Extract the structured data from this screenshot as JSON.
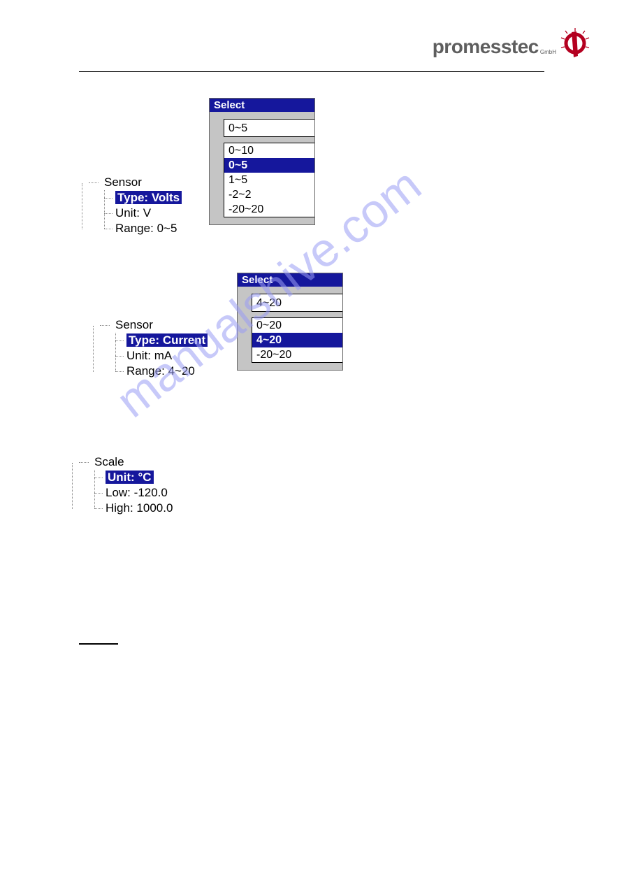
{
  "logo": {
    "brand": "promesstec",
    "suffix": "GmbH"
  },
  "watermark": "manualshive.com",
  "group1": {
    "tree": {
      "root": "Sensor",
      "type_label": "Type:",
      "type_value": "Volts",
      "unit_label": "Unit:",
      "unit_value": "V",
      "range_label": "Range:",
      "range_value": "0~5"
    },
    "select": {
      "title": "Select",
      "current": "0~5",
      "options": [
        "0~10",
        "0~5",
        "1~5",
        "-2~2",
        "-20~20"
      ],
      "highlighted": "0~5"
    }
  },
  "group2": {
    "tree": {
      "root": "Sensor",
      "type_label": "Type:",
      "type_value": "Current",
      "unit_label": "Unit:",
      "unit_value": "mA",
      "range_label": "Range:",
      "range_value": "4~20"
    },
    "select": {
      "title": "Select",
      "current": "4~20",
      "options": [
        "0~20",
        "4~20",
        "-20~20"
      ],
      "highlighted": "4~20"
    }
  },
  "group3": {
    "tree": {
      "root": "Scale",
      "unit_label": "Unit:",
      "unit_value": "°C",
      "low_label": "Low:",
      "low_value": "-120.0",
      "high_label": "High:",
      "high_value": "1000.0"
    }
  }
}
